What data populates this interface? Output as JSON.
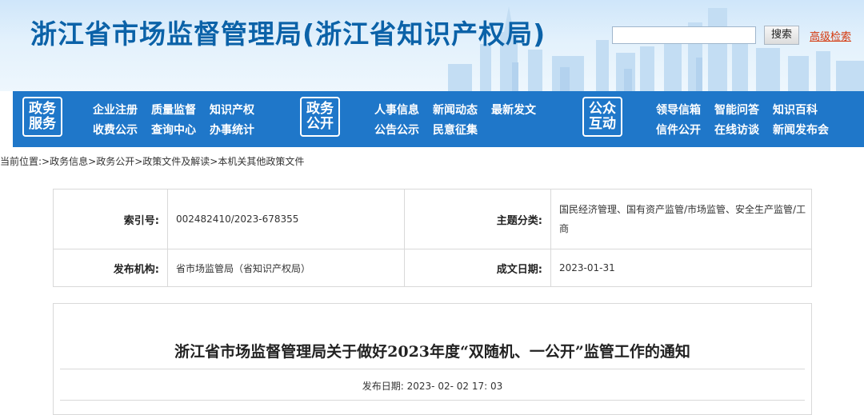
{
  "header": {
    "site_title": "浙江省市场监督管理局(浙江省知识产权局)",
    "search_button": "搜索",
    "advanced_search": "高级检索",
    "search_placeholder": ""
  },
  "nav": {
    "groups": [
      {
        "box_line1": "政务",
        "box_line2": "服务",
        "links": [
          "企业注册",
          "质量监督",
          "知识产权",
          "收费公示",
          "查询中心",
          "办事统计"
        ]
      },
      {
        "box_line1": "政务",
        "box_line2": "公开",
        "links": [
          "人事信息",
          "新闻动态",
          "最新发文",
          "公告公示",
          "民意征集"
        ]
      },
      {
        "box_line1": "公众",
        "box_line2": "互动",
        "links": [
          "领导信箱",
          "智能问答",
          "知识百科",
          "信件公开",
          "在线访谈",
          "新闻发布会"
        ]
      }
    ]
  },
  "breadcrumb": {
    "prefix": "当前位置:",
    "items": [
      "政务信息",
      "政务公开",
      "政策文件及解读",
      "本机关其他政策文件"
    ],
    "separator": ">"
  },
  "meta": {
    "index_label": "索引号:",
    "index_value": "002482410/2023-678355",
    "topic_label": "主题分类:",
    "topic_value": "国民经济管理、国有资产监管/市场监管、安全生产监管/工商",
    "publisher_label": "发布机构:",
    "publisher_value": "省市场监管局（省知识产权局）",
    "date_label": "成文日期:",
    "date_value": "2023-01-31"
  },
  "article": {
    "title": "浙江省市场监督管理局关于做好2023年度“双随机、一公开”监管工作的通知",
    "publish_label": "发布日期:",
    "publish_value": "2023- 02- 02 17: 03"
  },
  "colors": {
    "title_blue": "#0b62a8",
    "nav_blue": "#1f77c9",
    "link_red": "#d4380d"
  }
}
